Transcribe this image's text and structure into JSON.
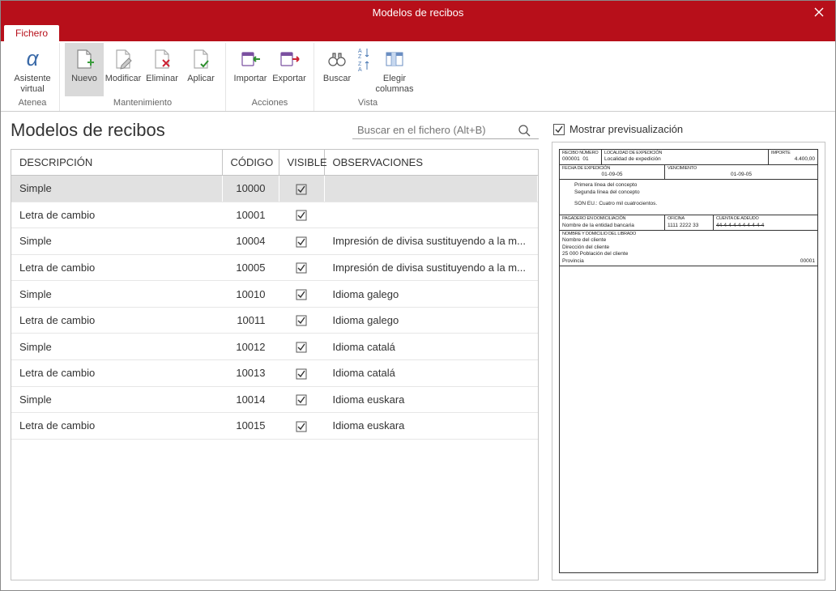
{
  "window": {
    "title": "Modelos de recibos"
  },
  "tabs": {
    "fichero": "Fichero"
  },
  "ribbon": {
    "atenea": {
      "label": "Asistente\nvirtual",
      "group": "Atenea"
    },
    "mantenimiento": {
      "label": "Mantenimiento",
      "nuevo": "Nuevo",
      "modificar": "Modificar",
      "eliminar": "Eliminar",
      "aplicar": "Aplicar"
    },
    "acciones": {
      "label": "Acciones",
      "importar": "Importar",
      "exportar": "Exportar"
    },
    "vista": {
      "label": "Vista",
      "buscar": "Buscar",
      "orden": "",
      "elegir": "Elegir\ncolumnas"
    }
  },
  "heading": "Modelos de recibos",
  "search": {
    "placeholder": "Buscar en el fichero (Alt+B)"
  },
  "columns": {
    "descripcion": "DESCRIPCIÓN",
    "codigo": "CÓDIGO",
    "visible": "VISIBLE",
    "observaciones": "OBSERVACIONES"
  },
  "rows": [
    {
      "desc": "Simple",
      "code": "10000",
      "visible": true,
      "obs": "",
      "selected": true
    },
    {
      "desc": "Letra de cambio",
      "code": "10001",
      "visible": true,
      "obs": ""
    },
    {
      "desc": "Simple",
      "code": "10004",
      "visible": true,
      "obs": "Impresión de divisa sustituyendo a la m..."
    },
    {
      "desc": "Letra de cambio",
      "code": "10005",
      "visible": true,
      "obs": "Impresión de divisa sustituyendo a la m..."
    },
    {
      "desc": "Simple",
      "code": "10010",
      "visible": true,
      "obs": "Idioma galego"
    },
    {
      "desc": "Letra de cambio",
      "code": "10011",
      "visible": true,
      "obs": "Idioma galego"
    },
    {
      "desc": "Simple",
      "code": "10012",
      "visible": true,
      "obs": "Idioma catalá"
    },
    {
      "desc": "Letra de cambio",
      "code": "10013",
      "visible": true,
      "obs": "Idioma catalá"
    },
    {
      "desc": "Simple",
      "code": "10014",
      "visible": true,
      "obs": "Idioma euskara"
    },
    {
      "desc": "Letra de cambio",
      "code": "10015",
      "visible": true,
      "obs": "Idioma euskara"
    }
  ],
  "preview_toggle": {
    "label": "Mostrar previsualización",
    "checked": true
  },
  "preview_doc": {
    "recibo_label": "RECIBO NÚMERO",
    "recibo": "000001",
    "serie": "01",
    "lugar_label": "LOCALIDAD DE EXPEDICIÓN",
    "lugar": "Localidad de expedición",
    "importe_label": "IMPORTE",
    "importe": "4.400,00",
    "fecha_label": "FECHA DE EXPEDICIÓN",
    "fecha": "01-09-05",
    "venc_label": "VENCIMIENTO",
    "venc": "01-09-05",
    "linea1": "Primera línea del concepto",
    "linea2": "Segunda línea del concepto",
    "son": "SON EU.:  Cuatro mil cuatrocientos.",
    "pagadero_label": "PAGADERO EN DOMICILIACIÓN",
    "entidad": "Nombre de la entidad bancaria",
    "oficina_label": "OFICINA",
    "oficina": "1111  2222  33",
    "cuenta_label": "CUENTA DE ADEUDO",
    "cuenta": "44-4-4-4-4-4-4-4-4-4",
    "cliente_label": "NOMBRE Y DOMICILIO DEL LIBRADO",
    "cliente": "Nombre del cliente",
    "dir": "Dirección del cliente",
    "pob": "25 000  Población del cliente",
    "prov": "Provincia",
    "num": "00001"
  }
}
